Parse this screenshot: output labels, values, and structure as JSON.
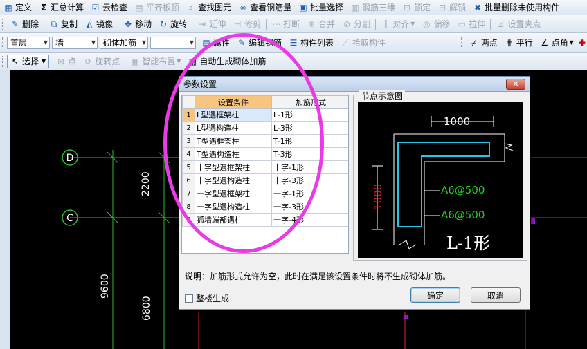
{
  "toolbar1": {
    "items": [
      {
        "label": "定义",
        "icon": "grid-icon"
      },
      {
        "label": "汇总计算",
        "icon": "sigma-icon"
      },
      {
        "label": "云检查",
        "icon": "cloud-check-icon"
      },
      {
        "label": "平齐板顶",
        "icon": "flat-top-icon",
        "disabled": true
      },
      {
        "label": "查找图元",
        "icon": "find-icon"
      },
      {
        "label": "查看钢筋量",
        "icon": "rebar-view-icon"
      },
      {
        "label": "批量选择",
        "icon": "batch-select-icon"
      },
      {
        "label": "钢筋三维",
        "icon": "rebar-3d-icon",
        "disabled": true
      },
      {
        "label": "锁定",
        "icon": "lock-icon",
        "disabled": true
      },
      {
        "label": "解锁",
        "icon": "unlock-icon",
        "disabled": true
      },
      {
        "label": "批量删除未使用构件",
        "icon": "batch-delete-icon"
      }
    ]
  },
  "toolbar2": {
    "items": [
      {
        "label": "删除",
        "icon": "delete-icon"
      },
      {
        "label": "复制",
        "icon": "copy-icon"
      },
      {
        "label": "镜像",
        "icon": "mirror-icon"
      },
      {
        "label": "移动",
        "icon": "move-icon"
      },
      {
        "label": "旋转",
        "icon": "rotate-icon"
      },
      {
        "label": "延伸",
        "icon": "extend-icon",
        "disabled": true
      },
      {
        "label": "修剪",
        "icon": "trim-icon",
        "disabled": true
      },
      {
        "label": "打断",
        "icon": "break-icon",
        "disabled": true
      },
      {
        "label": "合并",
        "icon": "merge-icon",
        "disabled": true
      },
      {
        "label": "分割",
        "icon": "split-icon",
        "disabled": true
      },
      {
        "label": "对齐",
        "icon": "align-icon",
        "disabled": true
      },
      {
        "label": "偏移",
        "icon": "offset-icon",
        "disabled": true
      },
      {
        "label": "拉伸",
        "icon": "stretch-icon",
        "disabled": true
      },
      {
        "label": "设置夹点",
        "icon": "grip-point-icon",
        "disabled": true
      }
    ]
  },
  "toolbar3": {
    "floor": "首层",
    "category": "墙",
    "component": "砌体加筋",
    "blank": "",
    "attr_label": "属性",
    "edit_rebar_label": "编辑钢筋",
    "component_list_label": "构件列表",
    "pick_component_label": "拾取构件",
    "two_points_label": "两点",
    "parallel_label": "平行",
    "point_angle_label": "点角"
  },
  "toolbar4": {
    "select_label": "选择",
    "point_label": "点",
    "rotate_point_label": "旋转点",
    "smart_layout_label": "智能布置",
    "auto_gen_label": "自动生成砌体加筋"
  },
  "canvas": {
    "axis_d": "D",
    "axis_c": "C",
    "dim_2200": "2200",
    "dim_9600": "9600",
    "dim_6800": "6800"
  },
  "dialog": {
    "title": "参数设置",
    "col_condition": "设置条件",
    "col_form": "加筋形式",
    "rows": [
      {
        "num": "1",
        "condition": "L型遇框架柱",
        "form": "L-1形"
      },
      {
        "num": "2",
        "condition": "L型遇构造柱",
        "form": "L-3形"
      },
      {
        "num": "3",
        "condition": "T型遇框架柱",
        "form": "T-1形"
      },
      {
        "num": "4",
        "condition": "T型遇构造柱",
        "form": "T-3形"
      },
      {
        "num": "5",
        "condition": "十字型遇框架柱",
        "form": "十字-1形"
      },
      {
        "num": "6",
        "condition": "十字型遇构造柱",
        "form": "十字-3形"
      },
      {
        "num": "7",
        "condition": "一字型遇框架柱",
        "form": "一字-1形"
      },
      {
        "num": "8",
        "condition": "一字型遇构造柱",
        "form": "一字-3形"
      },
      {
        "num": "9",
        "condition": "孤墙端部遇柱",
        "form": "一字-4形"
      }
    ],
    "preview_title": "节点示意图",
    "preview_dim_top": "1000",
    "preview_dim_left": "1000",
    "preview_rebar_1": "A6@500",
    "preview_rebar_2": "A6@500",
    "preview_shape": "L-1形",
    "note": "说明：加筋形式允许为空，此时在满足该设置条件时将不生成砌体加筋。",
    "whole_building_label": "整楼生成",
    "ok_label": "确定",
    "cancel_label": "取消"
  },
  "colors": {
    "highlight_oval": "#ea3ae8",
    "header_highlight": "#f7c57f",
    "rebar_cyan": "#22c8e8",
    "rebar_label_green": "#22d422",
    "dim_red": "#e02020"
  }
}
